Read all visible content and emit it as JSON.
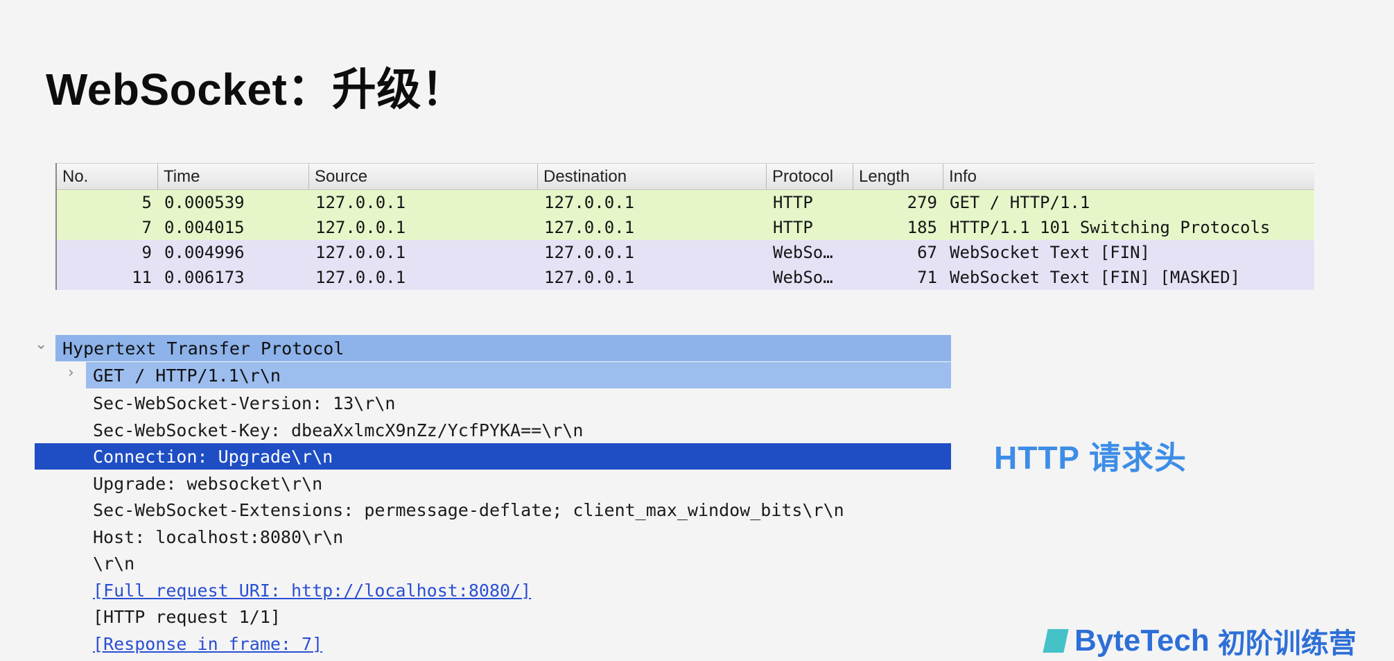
{
  "slide": {
    "title": "WebSocket：升级！",
    "annotation": "HTTP 请求头",
    "logo_text": "ByteTech",
    "logo_sub": "初阶训练营"
  },
  "packet_list": {
    "headers": [
      "No.",
      "Time",
      "Source",
      "Destination",
      "Protocol",
      "Length",
      "Info"
    ],
    "rows": [
      {
        "no": "5",
        "time": "0.000539",
        "source": "127.0.0.1",
        "destination": "127.0.0.1",
        "protocol": "HTTP",
        "length": "279",
        "info": "GET / HTTP/1.1",
        "color": "#e6f6c9"
      },
      {
        "no": "7",
        "time": "0.004015",
        "source": "127.0.0.1",
        "destination": "127.0.0.1",
        "protocol": "HTTP",
        "length": "185",
        "info": "HTTP/1.1 101 Switching Protocols",
        "color": "#e6f6c9"
      },
      {
        "no": "9",
        "time": "0.004996",
        "source": "127.0.0.1",
        "destination": "127.0.0.1",
        "protocol": "WebSo…",
        "length": "67",
        "info": "WebSocket Text [FIN]",
        "color": "#e5e2f6"
      },
      {
        "no": "11",
        "time": "0.006173",
        "source": "127.0.0.1",
        "destination": "127.0.0.1",
        "protocol": "WebSo…",
        "length": "71",
        "info": "WebSocket Text [FIN] [MASKED]",
        "color": "#e5e2f6"
      }
    ]
  },
  "detail_tree": {
    "root": "Hypertext Transfer Protocol",
    "request_line": "GET / HTTP/1.1\\r\\n",
    "lines": [
      {
        "text": "Sec-WebSocket-Version: 13\\r\\n",
        "style": "plain"
      },
      {
        "text": "Sec-WebSocket-Key: dbeaXxlmcX9nZz/YcfPYKA==\\r\\n",
        "style": "plain"
      },
      {
        "text": "Connection: Upgrade\\r\\n",
        "style": "selected"
      },
      {
        "text": "Upgrade: websocket\\r\\n",
        "style": "plain"
      },
      {
        "text": "Sec-WebSocket-Extensions: permessage-deflate; client_max_window_bits\\r\\n",
        "style": "plain"
      },
      {
        "text": "Host: localhost:8080\\r\\n",
        "style": "plain"
      },
      {
        "text": "\\r\\n",
        "style": "plain"
      },
      {
        "text": "[Full request URI: http://localhost:8080/]",
        "style": "link"
      },
      {
        "text": "[HTTP request 1/1]",
        "style": "plain"
      },
      {
        "text": "[Response in frame: 7]",
        "style": "link"
      }
    ],
    "colors": {
      "root_highlight": "#8db3ea",
      "request_highlight": "#9cbdee",
      "selected": "#1f4ec4",
      "link": "#2a4fd0"
    }
  }
}
